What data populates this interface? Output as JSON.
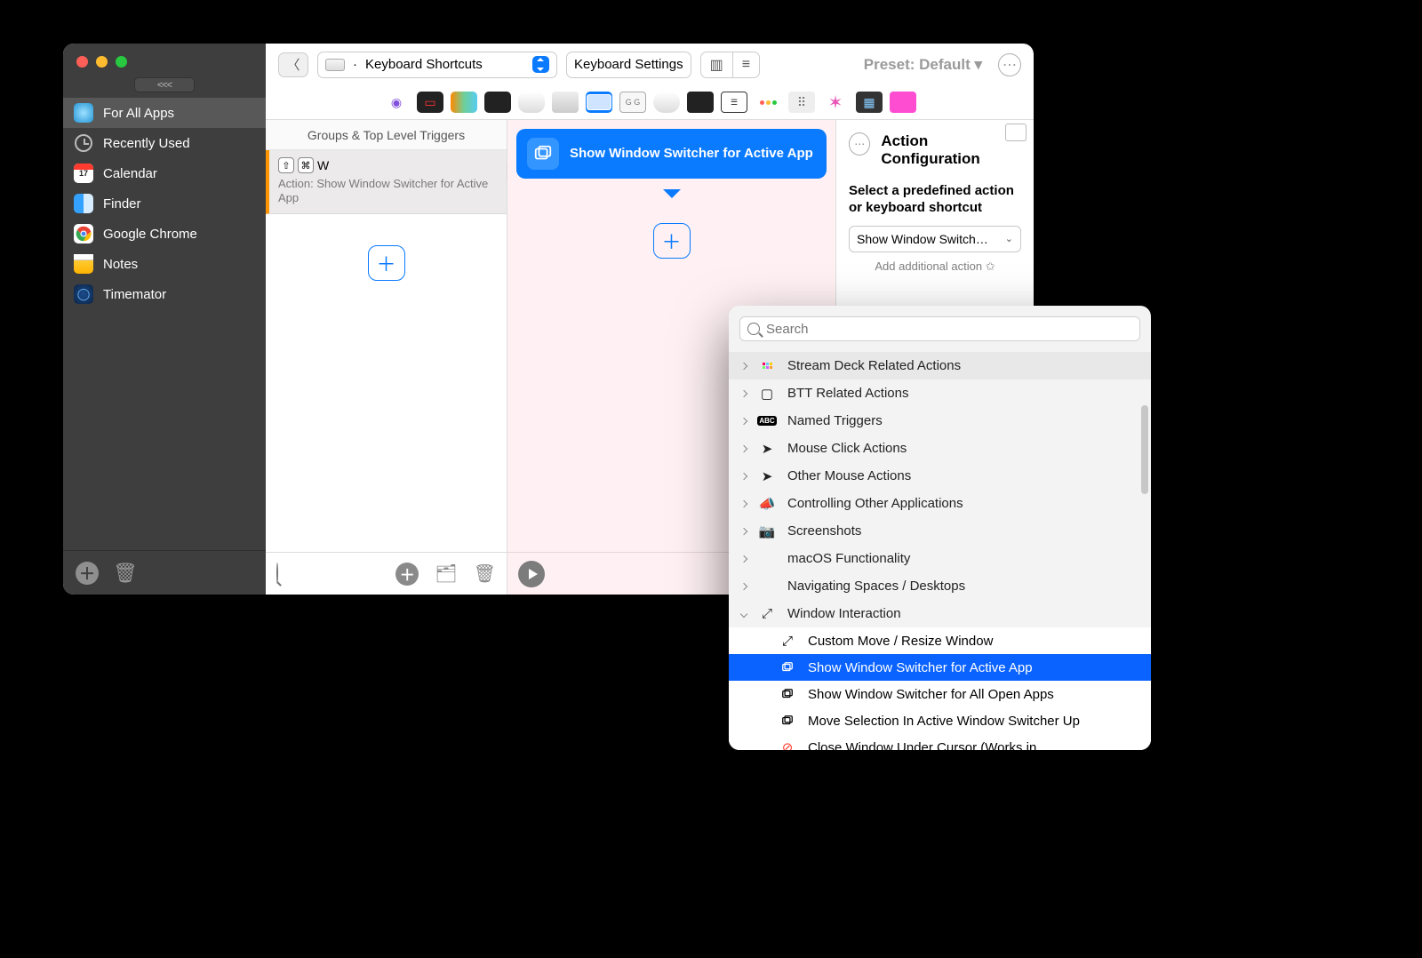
{
  "sidebar": {
    "collapse_glyph": "<<<",
    "items": [
      {
        "label": "For All Apps"
      },
      {
        "label": "Recently Used"
      },
      {
        "label": "Calendar"
      },
      {
        "label": "Finder"
      },
      {
        "label": "Google Chrome"
      },
      {
        "label": "Notes"
      },
      {
        "label": "Timemator"
      }
    ]
  },
  "toolbar": {
    "section_label": "Keyboard Shortcuts",
    "settings_label": "Keyboard Settings",
    "preset_label": "Preset: Default ▾"
  },
  "groups": {
    "header": "Groups & Top Level Triggers",
    "trigger_key": "W",
    "trigger_action_prefix": "Action: ",
    "trigger_action": "Show Window Switcher for Active App"
  },
  "action": {
    "title": "Show Window Switcher for Active App"
  },
  "conf": {
    "title": "Action Configuration",
    "help": "Select a predefined action or keyboard shortcut",
    "selected": "Show Window Switch…",
    "add_more": "Add additional action ✩"
  },
  "popover": {
    "search_placeholder": "Search",
    "categories": [
      "Stream Deck Related Actions",
      "BTT Related Actions",
      "Named Triggers",
      "Mouse Click Actions",
      "Other Mouse Actions",
      "Controlling Other Applications",
      "Screenshots",
      "macOS Functionality",
      "Navigating Spaces / Desktops",
      "Window Interaction"
    ],
    "subitems": [
      "Custom Move / Resize Window",
      "Show Window Switcher for Active App",
      "Show Window Switcher for All Open Apps",
      "Move Selection In Active Window Switcher Up",
      "Close Window Under Cursor (Works in"
    ]
  }
}
